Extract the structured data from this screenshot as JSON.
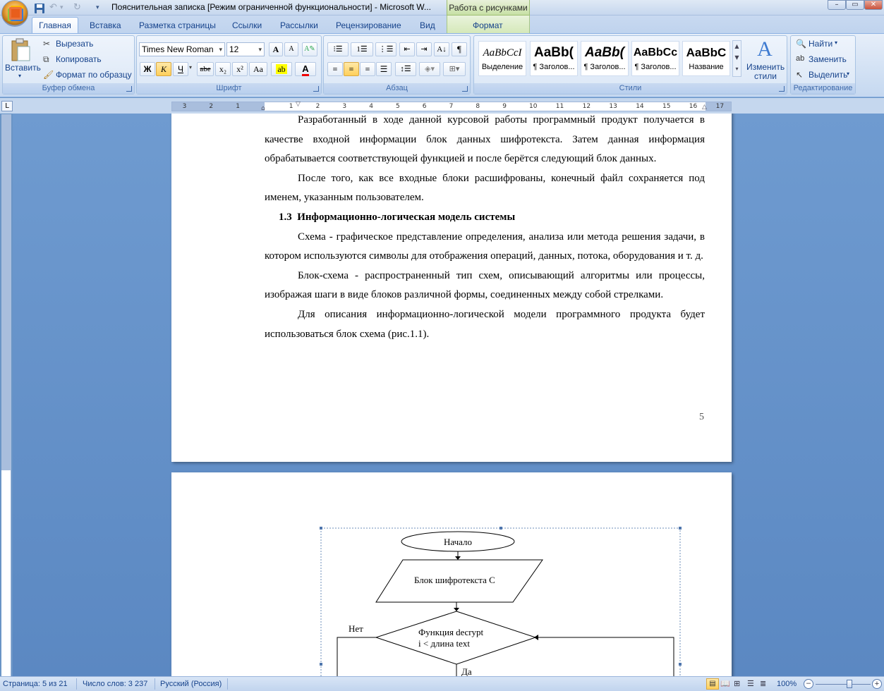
{
  "window": {
    "title": "Пояснительная записка [Режим ограниченной функциональности] - Microsoft W...",
    "context_tab_group": "Работа с рисунками"
  },
  "tabs": [
    {
      "label": "Главная"
    },
    {
      "label": "Вставка"
    },
    {
      "label": "Разметка страницы"
    },
    {
      "label": "Ссылки"
    },
    {
      "label": "Рассылки"
    },
    {
      "label": "Рецензирование"
    },
    {
      "label": "Вид"
    },
    {
      "label": "Формат"
    }
  ],
  "ribbon": {
    "clipboard": {
      "paste": "Вставить",
      "cut": "Вырезать",
      "copy": "Копировать",
      "format_painter": "Формат по образцу",
      "label": "Буфер обмена"
    },
    "font": {
      "name": "Times New Roman",
      "size": "12",
      "bold": "Ж",
      "italic": "К",
      "underline": "Ч",
      "strike": "abe",
      "subscript": "x₂",
      "superscript": "x²",
      "change_case": "Aa",
      "grow": "A",
      "shrink": "A",
      "label": "Шрифт"
    },
    "paragraph": {
      "label": "Абзац"
    },
    "styles": {
      "items": [
        {
          "preview": "AaBbCcI",
          "name": "Выделение"
        },
        {
          "preview": "AaBb(",
          "name": "¶ Заголов..."
        },
        {
          "preview": "AaBb(",
          "name": "¶ Заголов..."
        },
        {
          "preview": "AaBbCc",
          "name": "¶ Заголов..."
        },
        {
          "preview": "AaBbC",
          "name": "Название"
        }
      ],
      "change_styles": "Изменить стили",
      "label": "Стили"
    },
    "editing": {
      "find": "Найти",
      "replace": "Заменить",
      "select": "Выделить",
      "label": "Редактирование"
    }
  },
  "ruler": {
    "h_ticks": [
      "3",
      "2",
      "1",
      "1",
      "2",
      "3",
      "4",
      "5",
      "6",
      "7",
      "8",
      "9",
      "10",
      "11",
      "12",
      "13",
      "14",
      "15",
      "16",
      "17"
    ]
  },
  "document": {
    "page1": {
      "paragraphs": [
        "Разработанный в ходе данной курсовой работы программный продукт получается в качестве входной информации блок данных шифротекста. Затем данная информация обрабатывается соответствующей функцией и после берётся следующий блок данных.",
        "После того, как все входные блоки расшифрованы, конечный файл сохраняется под именем, указанным пользователем."
      ],
      "heading_num": "1.3",
      "heading": "Информационно-логическая модель системы",
      "paragraphs2": [
        "Схема - графическое представление определения, анализа или метода решения задачи, в котором используются символы для отображения операций, данных, потока, оборудования и т. д.",
        "Блок-схема - распространенный тип схем, описывающий алгоритмы или процессы, изображая шаги в виде блоков различной формы, соединенных между собой стрелками.",
        "Для описания информационно-логической модели программного продукта будет использоваться блок схема (рис.1.1)."
      ],
      "page_number": "5"
    },
    "flowchart": {
      "start": "Начало",
      "input_block": "Блок шифротекста C",
      "decision_line1": "Функция decrypt",
      "decision_line2": "i < длина text",
      "no_label": "Нет",
      "yes_label": "Да"
    }
  },
  "statusbar": {
    "page": "Страница: 5 из 21",
    "words": "Число слов: 3 237",
    "language": "Русский (Россия)",
    "zoom": "100%"
  }
}
